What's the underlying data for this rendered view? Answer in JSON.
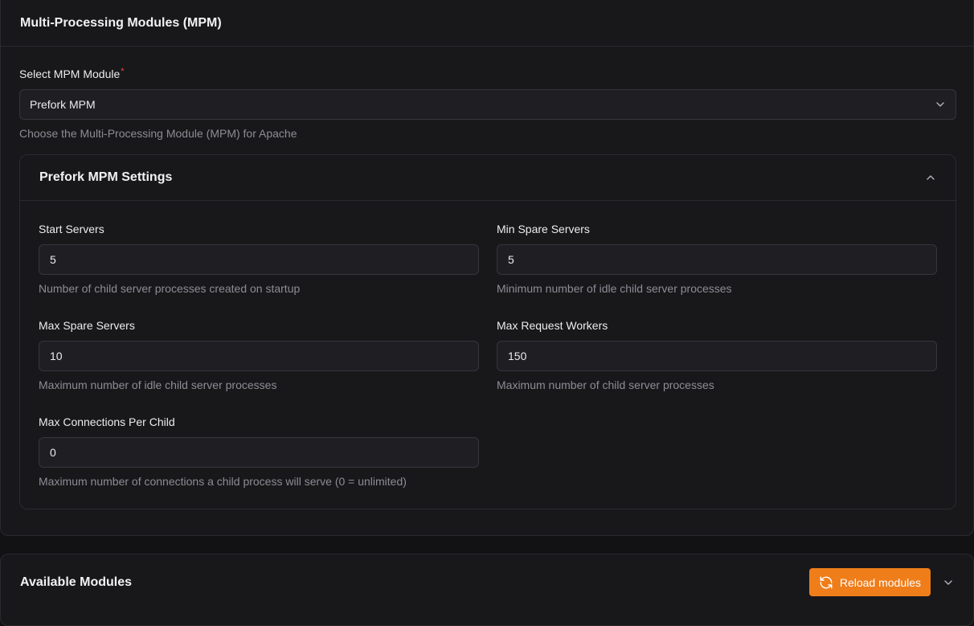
{
  "mpm": {
    "title": "Multi-Processing Modules (MPM)",
    "select_label": "Select MPM Module",
    "required_mark": "*",
    "selected_value": "Prefork MPM",
    "select_hint": "Choose the Multi-Processing Module (MPM) for Apache",
    "settings": {
      "title": "Prefork MPM Settings",
      "fields": [
        {
          "label": "Start Servers",
          "value": "5",
          "hint": "Number of child server processes created on startup"
        },
        {
          "label": "Min Spare Servers",
          "value": "5",
          "hint": "Minimum number of idle child server processes"
        },
        {
          "label": "Max Spare Servers",
          "value": "10",
          "hint": "Maximum number of idle child server processes"
        },
        {
          "label": "Max Request Workers",
          "value": "150",
          "hint": "Maximum number of child server processes"
        },
        {
          "label": "Max Connections Per Child",
          "value": "0",
          "hint": "Maximum number of connections a child process will serve (0 = unlimited)"
        }
      ]
    }
  },
  "modules": {
    "title": "Available Modules",
    "reload_label": "Reload modules"
  },
  "icons": {
    "select_chevron": "chevron-down-icon",
    "collapse": "chevron-up-icon",
    "reload": "refresh-icon",
    "expand": "chevron-down-icon"
  },
  "colors": {
    "accent": "#ef7d1a",
    "required": "#ef4444"
  }
}
